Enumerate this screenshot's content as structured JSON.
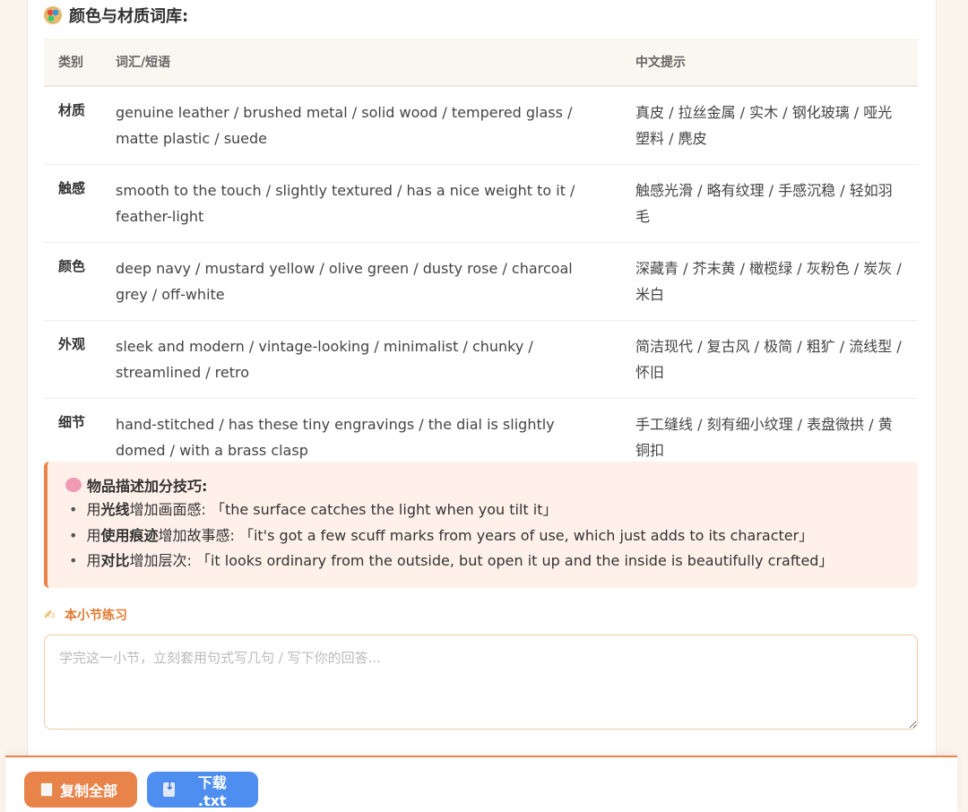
{
  "section": {
    "title": "颜色与材质词库:",
    "icon": "palette-icon"
  },
  "table": {
    "headers": [
      "类别",
      "词汇/短语",
      "中文提示"
    ],
    "rows": [
      {
        "category": "材质",
        "english": "genuine leather / brushed metal / solid wood / tempered glass / matte plastic / suede",
        "chinese": "真皮 / 拉丝金属 / 实木 / 钢化玻璃 / 哑光塑料 / 麂皮"
      },
      {
        "category": "触感",
        "english": "smooth to the touch / slightly textured / has a nice weight to it / feather-light",
        "chinese": "触感光滑 / 略有纹理 / 手感沉稳 / 轻如羽毛"
      },
      {
        "category": "颜色",
        "english": "deep navy / mustard yellow / olive green / dusty rose / charcoal grey / off-white",
        "chinese": "深藏青 / 芥末黄 / 橄榄绿 / 灰粉色 / 炭灰 / 米白"
      },
      {
        "category": "外观",
        "english": "sleek and modern / vintage-looking / minimalist / chunky / streamlined / retro",
        "chinese": "简洁现代 / 复古风 / 极简 / 粗犷 / 流线型 / 怀旧"
      },
      {
        "category": "细节",
        "english": "hand-stitched / has these tiny engravings / the dial is slightly domed / with a brass clasp",
        "chinese": "手工缝线 / 刻有细小纹理 / 表盘微拱 / 黄铜扣"
      }
    ]
  },
  "tips": {
    "title": "物品描述加分技巧:",
    "icon": "brain-icon",
    "items": [
      {
        "pre": "用",
        "bold": "光线",
        "post": "增加画面感: 「the surface catches the light when you tilt it」"
      },
      {
        "pre": "用",
        "bold": "使用痕迹",
        "post": "增加故事感: 「it's got a few scuff marks from years of use, which just adds to its character」"
      },
      {
        "pre": "用",
        "bold": "对比",
        "post": "增加层次: 「it looks ordinary from the outside, but open it up and the inside is beautifully crafted」"
      }
    ]
  },
  "practice": {
    "label": "本小节练习",
    "icon": "writing-hand-icon",
    "placeholder": "学完这一小节，立刻套用句式写几句 / 写下你的回答...",
    "value": ""
  },
  "bottom_bar": {
    "copy_label": "复制全部",
    "download_label": "下载 .txt"
  },
  "colors": {
    "accent_orange": "#e8834a",
    "accent_blue": "#4d8ef0",
    "tips_background": "#fff1ea"
  }
}
